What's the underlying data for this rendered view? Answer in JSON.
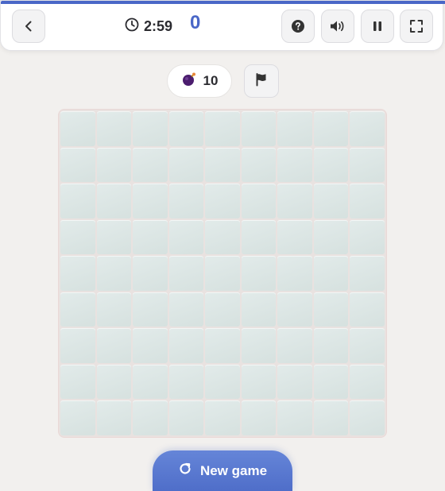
{
  "header": {
    "timer": "2:59",
    "score": "0",
    "accent_color": "#4a67c7",
    "buttons": {
      "back": "back-icon",
      "help": "help-icon",
      "sound": "volume-icon",
      "pause": "pause-icon",
      "fullscreen": "fullscreen-icon"
    }
  },
  "status": {
    "mines_remaining": "10",
    "mine_icon": "bomb-icon",
    "flag_icon": "flag-icon"
  },
  "board": {
    "rows": 9,
    "cols": 9,
    "state": "all-covered"
  },
  "actions": {
    "new_game_label": "New game",
    "new_game_icon": "restart-icon"
  }
}
